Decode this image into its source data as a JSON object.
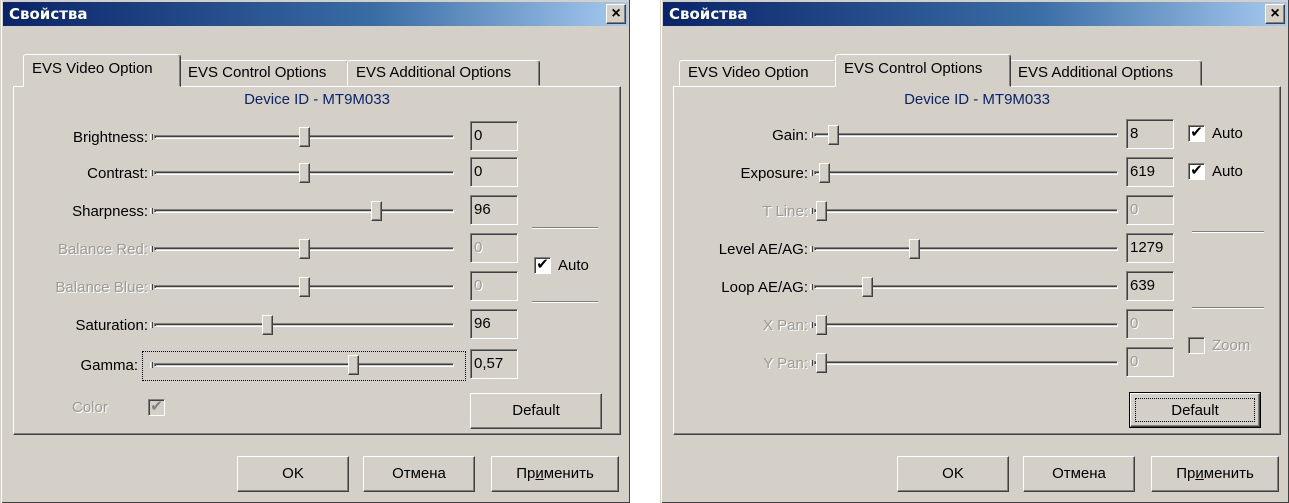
{
  "dialog1": {
    "title": "Свойства",
    "close_label": "×",
    "tabs": [
      {
        "label": "EVS Video Option",
        "active": true
      },
      {
        "label": "EVS Control Options",
        "active": false
      },
      {
        "label": "EVS Additional Options",
        "active": false
      }
    ],
    "device_id": "Device ID - MT9M033",
    "rows": [
      {
        "label": "Brightness:",
        "value": "0",
        "level": 0.5,
        "enabled": true
      },
      {
        "label": "Contrast:",
        "value": "0",
        "level": 0.5,
        "enabled": true
      },
      {
        "label": "Sharpness:",
        "value": "96",
        "level": 0.75,
        "enabled": true
      },
      {
        "label": "Balance Red:",
        "value": "0",
        "level": 0.5,
        "enabled": false
      },
      {
        "label": "Balance Blue:",
        "value": "0",
        "level": 0.5,
        "enabled": false
      },
      {
        "label": "Saturation:",
        "value": "96",
        "level": 0.37,
        "enabled": true
      },
      {
        "label": "Gamma:",
        "value": "0,57",
        "level": 0.67,
        "enabled": true
      }
    ],
    "auto": {
      "label": "Auto",
      "checked": true
    },
    "color": {
      "label": "Color",
      "checked": true,
      "enabled": false
    },
    "default_label": "Default",
    "ok_label": "OK",
    "cancel_label": "Отмена",
    "apply_label": "Применить",
    "apply_mnemonic_index": 2
  },
  "dialog2": {
    "title": "Свойства",
    "close_label": "×",
    "tabs": [
      {
        "label": "EVS Video Option",
        "active": false
      },
      {
        "label": "EVS Control Options",
        "active": true
      },
      {
        "label": "EVS Additional Options",
        "active": false
      }
    ],
    "device_id": "Device ID - MT9M033",
    "rows": [
      {
        "label": "Gain:",
        "value": "8",
        "level": 0.04,
        "enabled": true
      },
      {
        "label": "Exposure:",
        "value": "619",
        "level": 0.01,
        "enabled": true
      },
      {
        "label": "T Line:",
        "value": "0",
        "level": 0.0,
        "enabled": false
      },
      {
        "label": "Level AE/AG:",
        "value": "1279",
        "level": 0.32,
        "enabled": true
      },
      {
        "label": "Loop AE/AG:",
        "value": "639",
        "level": 0.16,
        "enabled": true
      },
      {
        "label": "X Pan:",
        "value": "0",
        "level": 0.0,
        "enabled": false
      },
      {
        "label": "Y Pan:",
        "value": "0",
        "level": 0.0,
        "enabled": false
      }
    ],
    "gain_auto": {
      "label": "Auto",
      "checked": true
    },
    "exposure_auto": {
      "label": "Auto",
      "checked": true
    },
    "zoom": {
      "label": "Zoom",
      "checked": false,
      "enabled": false
    },
    "default_label": "Default",
    "ok_label": "OK",
    "cancel_label": "Отмена",
    "apply_label": "Применить",
    "apply_mnemonic_index": 2
  }
}
